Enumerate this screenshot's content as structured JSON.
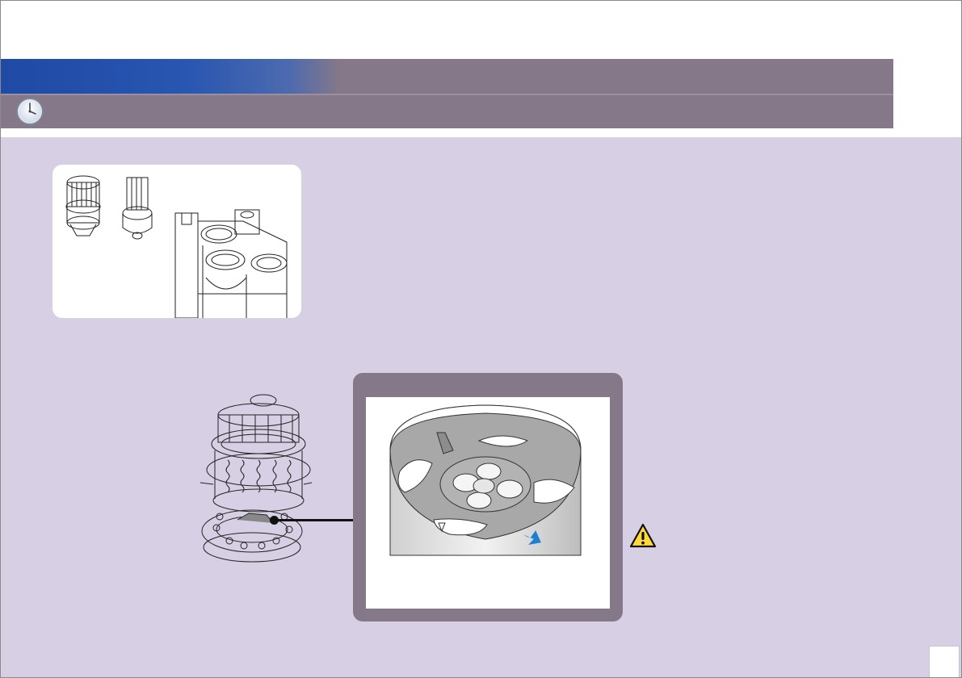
{
  "header": {
    "title": "",
    "clock_icon": "clock-icon",
    "colors": {
      "blue_tab": "#1f4aa6",
      "band": "#857889",
      "content_bg": "#d7d0e5"
    }
  },
  "figures": {
    "thumbnail_card": {
      "icons": [
        "rotor-assembly-icon",
        "rotor-cutaway-icon",
        "machine-block-icon"
      ]
    },
    "rotor_drawing": {
      "icon": "rotor-exploded-icon"
    },
    "detail_view": {
      "icon": "disc-detail-icon",
      "arrow_color": "#1e7fd0"
    }
  },
  "warning": {
    "icon": "warning-icon"
  },
  "footer": {
    "page_number": ""
  }
}
